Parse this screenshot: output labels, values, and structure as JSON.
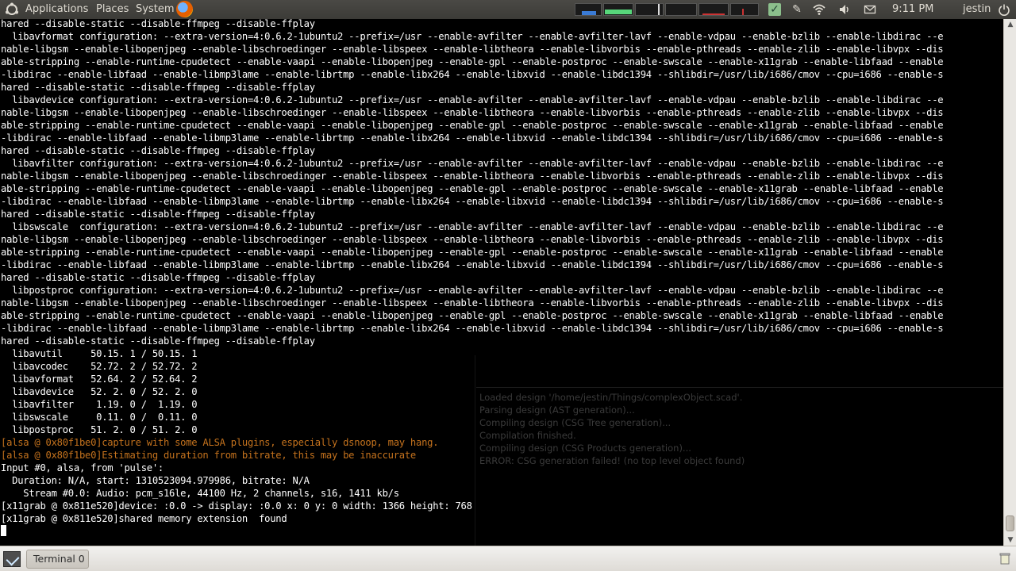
{
  "top_panel": {
    "menus": [
      "Applications",
      "Places",
      "System"
    ],
    "clock": "9:11 PM",
    "username": "jestin"
  },
  "terminal": {
    "lines": [
      {
        "text": "hared --disable-static --disable-ffmpeg --disable-ffplay",
        "style": "normal"
      },
      {
        "text": "  libavformat configuration: --extra-version=4:0.6.2-1ubuntu2 --prefix=/usr --enable-avfilter --enable-avfilter-lavf --enable-vdpau --enable-bzlib --enable-libdirac --e",
        "style": "normal"
      },
      {
        "text": "nable-libgsm --enable-libopenjpeg --enable-libschroedinger --enable-libspeex --enable-libtheora --enable-libvorbis --enable-pthreads --enable-zlib --enable-libvpx --dis",
        "style": "normal"
      },
      {
        "text": "able-stripping --enable-runtime-cpudetect --enable-vaapi --enable-libopenjpeg --enable-gpl --enable-postproc --enable-swscale --enable-x11grab --enable-libfaad --enable",
        "style": "normal"
      },
      {
        "text": "-libdirac --enable-libfaad --enable-libmp3lame --enable-librtmp --enable-libx264 --enable-libxvid --enable-libdc1394 --shlibdir=/usr/lib/i686/cmov --cpu=i686 --enable-s",
        "style": "normal"
      },
      {
        "text": "hared --disable-static --disable-ffmpeg --disable-ffplay",
        "style": "normal"
      },
      {
        "text": "  libavdevice configuration: --extra-version=4:0.6.2-1ubuntu2 --prefix=/usr --enable-avfilter --enable-avfilter-lavf --enable-vdpau --enable-bzlib --enable-libdirac --e",
        "style": "normal"
      },
      {
        "text": "nable-libgsm --enable-libopenjpeg --enable-libschroedinger --enable-libspeex --enable-libtheora --enable-libvorbis --enable-pthreads --enable-zlib --enable-libvpx --dis",
        "style": "normal"
      },
      {
        "text": "able-stripping --enable-runtime-cpudetect --enable-vaapi --enable-libopenjpeg --enable-gpl --enable-postproc --enable-swscale --enable-x11grab --enable-libfaad --enable",
        "style": "normal"
      },
      {
        "text": "-libdirac --enable-libfaad --enable-libmp3lame --enable-librtmp --enable-libx264 --enable-libxvid --enable-libdc1394 --shlibdir=/usr/lib/i686/cmov --cpu=i686 --enable-s",
        "style": "normal"
      },
      {
        "text": "hared --disable-static --disable-ffmpeg --disable-ffplay",
        "style": "normal"
      },
      {
        "text": "  libavfilter configuration: --extra-version=4:0.6.2-1ubuntu2 --prefix=/usr --enable-avfilter --enable-avfilter-lavf --enable-vdpau --enable-bzlib --enable-libdirac --e",
        "style": "normal"
      },
      {
        "text": "nable-libgsm --enable-libopenjpeg --enable-libschroedinger --enable-libspeex --enable-libtheora --enable-libvorbis --enable-pthreads --enable-zlib --enable-libvpx --dis",
        "style": "normal"
      },
      {
        "text": "able-stripping --enable-runtime-cpudetect --enable-vaapi --enable-libopenjpeg --enable-gpl --enable-postproc --enable-swscale --enable-x11grab --enable-libfaad --enable",
        "style": "normal"
      },
      {
        "text": "-libdirac --enable-libfaad --enable-libmp3lame --enable-librtmp --enable-libx264 --enable-libxvid --enable-libdc1394 --shlibdir=/usr/lib/i686/cmov --cpu=i686 --enable-s",
        "style": "normal"
      },
      {
        "text": "hared --disable-static --disable-ffmpeg --disable-ffplay",
        "style": "normal"
      },
      {
        "text": "  libswscale  configuration: --extra-version=4:0.6.2-1ubuntu2 --prefix=/usr --enable-avfilter --enable-avfilter-lavf --enable-vdpau --enable-bzlib --enable-libdirac --e",
        "style": "normal"
      },
      {
        "text": "nable-libgsm --enable-libopenjpeg --enable-libschroedinger --enable-libspeex --enable-libtheora --enable-libvorbis --enable-pthreads --enable-zlib --enable-libvpx --dis",
        "style": "normal"
      },
      {
        "text": "able-stripping --enable-runtime-cpudetect --enable-vaapi --enable-libopenjpeg --enable-gpl --enable-postproc --enable-swscale --enable-x11grab --enable-libfaad --enable",
        "style": "normal"
      },
      {
        "text": "-libdirac --enable-libfaad --enable-libmp3lame --enable-librtmp --enable-libx264 --enable-libxvid --enable-libdc1394 --shlibdir=/usr/lib/i686/cmov --cpu=i686 --enable-s",
        "style": "normal"
      },
      {
        "text": "hared --disable-static --disable-ffmpeg --disable-ffplay",
        "style": "normal"
      },
      {
        "text": "  libpostproc configuration: --extra-version=4:0.6.2-1ubuntu2 --prefix=/usr --enable-avfilter --enable-avfilter-lavf --enable-vdpau --enable-bzlib --enable-libdirac --e",
        "style": "normal"
      },
      {
        "text": "nable-libgsm --enable-libopenjpeg --enable-libschroedinger --enable-libspeex --enable-libtheora --enable-libvorbis --enable-pthreads --enable-zlib --enable-libvpx --dis",
        "style": "normal"
      },
      {
        "text": "able-stripping --enable-runtime-cpudetect --enable-vaapi --enable-libopenjpeg --enable-gpl --enable-postproc --enable-swscale --enable-x11grab --enable-libfaad --enable",
        "style": "normal"
      },
      {
        "text": "-libdirac --enable-libfaad --enable-libmp3lame --enable-librtmp --enable-libx264 --enable-libxvid --enable-libdc1394 --shlibdir=/usr/lib/i686/cmov --cpu=i686 --enable-s",
        "style": "normal"
      },
      {
        "text": "hared --disable-static --disable-ffmpeg --disable-ffplay",
        "style": "normal"
      },
      {
        "text": "  libavutil     50.15. 1 / 50.15. 1",
        "style": "normal"
      },
      {
        "text": "  libavcodec    52.72. 2 / 52.72. 2",
        "style": "normal"
      },
      {
        "text": "  libavformat   52.64. 2 / 52.64. 2",
        "style": "normal"
      },
      {
        "text": "  libavdevice   52. 2. 0 / 52. 2. 0",
        "style": "normal"
      },
      {
        "text": "  libavfilter    1.19. 0 /  1.19. 0",
        "style": "normal"
      },
      {
        "text": "  libswscale     0.11. 0 /  0.11. 0",
        "style": "normal"
      },
      {
        "text": "  libpostproc   51. 2. 0 / 51. 2. 0",
        "style": "normal"
      },
      {
        "text": "[alsa @ 0x80f1be0]capture with some ALSA plugins, especially dsnoop, may hang.",
        "style": "warn"
      },
      {
        "text": "[alsa @ 0x80f1be0]Estimating duration from bitrate, this may be inaccurate",
        "style": "warn"
      },
      {
        "text": "Input #0, alsa, from 'pulse':",
        "style": "normal"
      },
      {
        "text": "  Duration: N/A, start: 1310523094.979986, bitrate: N/A",
        "style": "normal"
      },
      {
        "text": "    Stream #0.0: Audio: pcm_s16le, 44100 Hz, 2 channels, s16, 1411 kb/s",
        "style": "normal"
      },
      {
        "text": "[x11grab @ 0x811e520]device: :0.0 -> display: :0.0 x: 0 y: 0 width: 1366 height: 768",
        "style": "normal"
      },
      {
        "text": "[x11grab @ 0x811e520]shared memory extension  found",
        "style": "normal"
      }
    ]
  },
  "background_window": {
    "lines": [
      "Loaded design '/home/jestin/Things/complexObject.scad'.",
      "Parsing design (AST generation)...",
      "Compiling design (CSG Tree generation)...",
      "Compilation finished.",
      "Compiling design (CSG Products generation)...",
      "ERROR: CSG generation failed! (no top level object found)"
    ]
  },
  "bottom_panel": {
    "task_label": "Terminal 0"
  },
  "icons": {
    "distro": "distro-logo-icon",
    "browser": "firefox-icon",
    "network": "wifi-icon",
    "volume": "volume-icon",
    "mail": "mail-icon",
    "power": "power-icon",
    "show_desktop": "show-desktop-icon",
    "trash": "trash-icon"
  },
  "colors": {
    "terminal_bg": "#000000",
    "terminal_fg": "#ffffff",
    "warning_fg": "#c4721d",
    "panel_bg": "#3c3b37",
    "bottom_panel_bg": "#dedbd6"
  }
}
